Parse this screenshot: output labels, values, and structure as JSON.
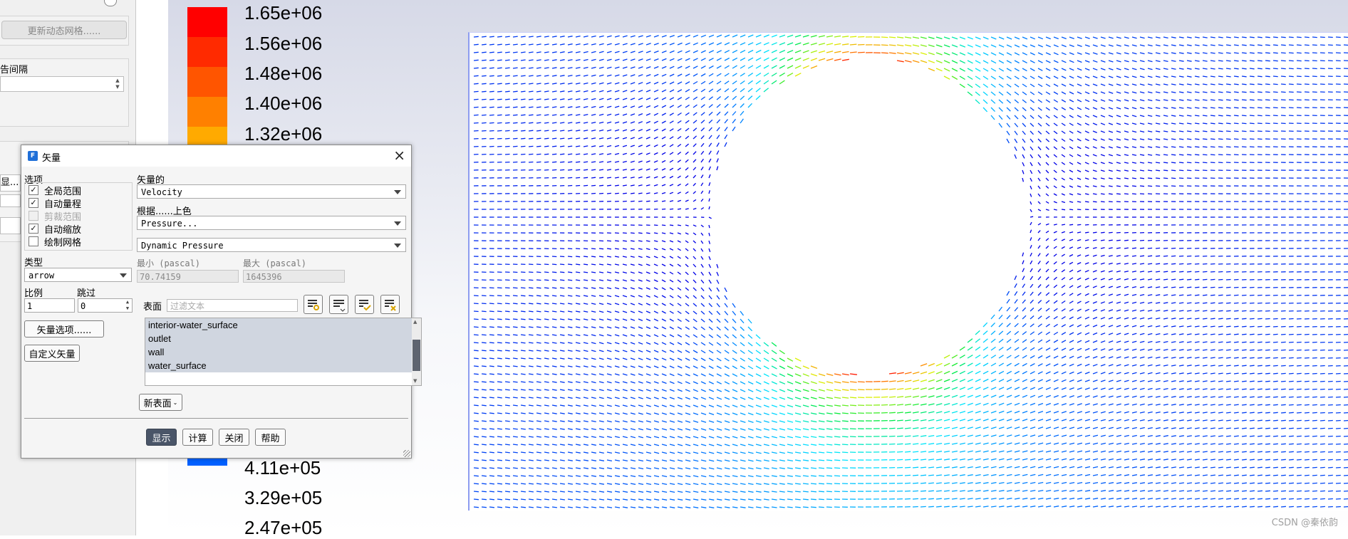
{
  "task_panel": {
    "update_mesh_button": "更新动态网格......",
    "report_interval_label": "告间隔",
    "stub_text": "显..."
  },
  "colorbar": {
    "labels": [
      "1.65e+06",
      "1.56e+06",
      "1.48e+06",
      "1.40e+06",
      "1.32e+06",
      "4.11e+05",
      "3.29e+05",
      "2.47e+05"
    ],
    "colors": [
      "#ff0000",
      "#ff2a00",
      "#ff5500",
      "#ff8000",
      "#ffaa00",
      "#00c8ff",
      "#0090ff",
      "#0060ff",
      "#0040ff"
    ]
  },
  "watermark": "CSDN @秦依韵",
  "dialog": {
    "title": "矢量",
    "options_label": "选项",
    "options": [
      {
        "label": "全局范围",
        "checked": true,
        "enabled": true
      },
      {
        "label": "自动量程",
        "checked": true,
        "enabled": true
      },
      {
        "label": "剪裁范围",
        "checked": false,
        "enabled": false
      },
      {
        "label": "自动缩放",
        "checked": true,
        "enabled": true
      },
      {
        "label": "绘制网格",
        "checked": false,
        "enabled": true
      }
    ],
    "vectors_of_label": "矢量的",
    "vectors_of_value": "Velocity",
    "color_by_label": "根据......上色",
    "color_by_value": "Pressure...",
    "color_by_sub_value": "Dynamic Pressure",
    "type_label": "类型",
    "type_value": "arrow",
    "min_label": "最小 (pascal)",
    "min_value": "70.74159",
    "max_label": "最大 (pascal)",
    "max_value": "1645396",
    "scale_label": "比例",
    "scale_value": "1",
    "skip_label": "跳过",
    "skip_value": "0",
    "vector_options_button": "矢量选项......",
    "custom_vectors_button": "自定义矢量",
    "surfaces_label": "表面",
    "filter_placeholder": "过滤文本",
    "surfaces": [
      "interior-water_surface",
      "outlet",
      "wall",
      "water_surface"
    ],
    "new_surface_button": "新表面",
    "buttons": {
      "display": "显示",
      "compute": "计算",
      "close": "关闭",
      "help": "帮助"
    },
    "close_icon": "×"
  }
}
